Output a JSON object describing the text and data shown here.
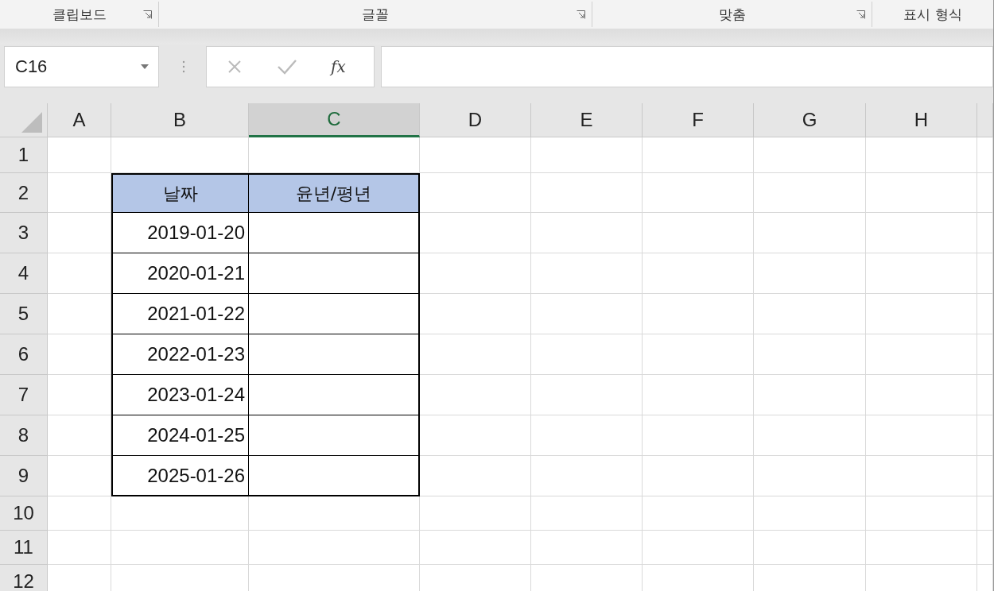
{
  "ribbon_groups": [
    {
      "label": "클립보드",
      "launcher": true
    },
    {
      "label": "글꼴",
      "launcher": true
    },
    {
      "label": "맞춤",
      "launcher": true
    },
    {
      "label": "표시 형식",
      "launcher": false
    }
  ],
  "formula_bar": {
    "name_box": "C16",
    "function_button": "fx"
  },
  "columns": [
    {
      "label": "A",
      "selected": false
    },
    {
      "label": "B",
      "selected": false
    },
    {
      "label": "C",
      "selected": true
    },
    {
      "label": "D",
      "selected": false
    },
    {
      "label": "E",
      "selected": false
    },
    {
      "label": "F",
      "selected": false
    },
    {
      "label": "G",
      "selected": false
    },
    {
      "label": "H",
      "selected": false
    }
  ],
  "rows": [
    "1",
    "2",
    "3",
    "4",
    "5",
    "6",
    "7",
    "8",
    "9",
    "10",
    "11",
    "12"
  ],
  "table": {
    "headers": [
      "날짜",
      "윤년/평년"
    ],
    "dates": [
      "2019-01-20",
      "2020-01-21",
      "2021-01-22",
      "2022-01-23",
      "2023-01-24",
      "2024-01-25",
      "2025-01-26"
    ]
  }
}
